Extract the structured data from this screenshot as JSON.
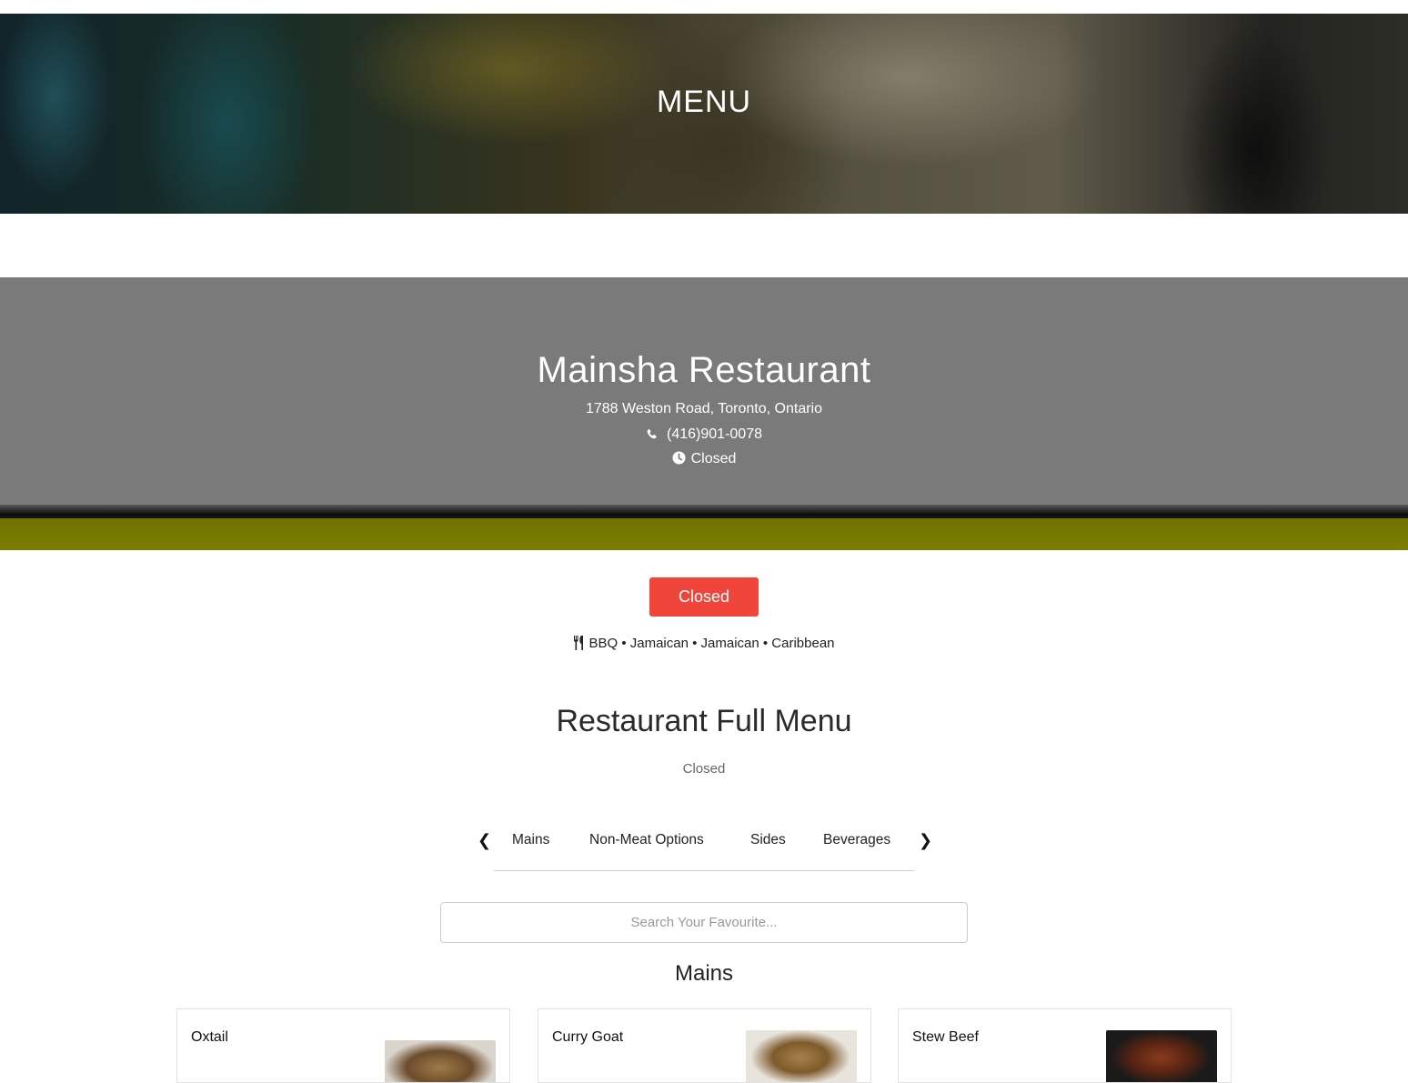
{
  "hero": {
    "title": "MENU"
  },
  "restaurant": {
    "name": "Mainsha Restaurant",
    "address": "1788 Weston Road, Toronto, Ontario",
    "phone": "(416)901-0078",
    "hours_status": "Closed",
    "phone_icon": "phone-icon",
    "clock_icon": "clock-icon"
  },
  "status_button": {
    "label": "Closed",
    "color": "#f0453a"
  },
  "cuisine": {
    "icon": "utensils-icon",
    "text": "BBQ • Jamaican • Jamaican • Caribbean"
  },
  "menu": {
    "heading": "Restaurant Full Menu",
    "status": "Closed",
    "prev_arrow": "❮",
    "next_arrow": "❯",
    "tabs": [
      {
        "label": "Mains"
      },
      {
        "label": "Non-Meat Options"
      },
      {
        "label": "Sides"
      },
      {
        "label": "Beverages"
      }
    ]
  },
  "search": {
    "placeholder": "Search Your Favourite...",
    "value": ""
  },
  "section": {
    "title": "Mains",
    "items": [
      {
        "name": "Oxtail"
      },
      {
        "name": "Curry Goat"
      },
      {
        "name": "Stew Beef"
      }
    ]
  },
  "colors": {
    "accent_closed": "#f0453a",
    "banner_olive": "#7d7f00"
  }
}
